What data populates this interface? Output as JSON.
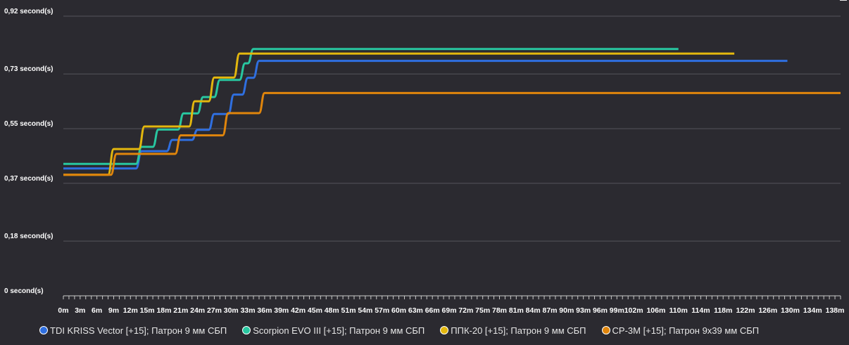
{
  "chart_data": {
    "type": "line",
    "step": true,
    "y_ticks": [
      "0 second(s)",
      "0,18 second(s)",
      "0,37 second(s)",
      "0,55 second(s)",
      "0,73 second(s)",
      "0,92 second(s)"
    ],
    "y_tick_values": [
      0,
      0.18,
      0.37,
      0.55,
      0.73,
      0.92
    ],
    "ylim": [
      0,
      0.92
    ],
    "x_ticks": [
      "0m",
      "3m",
      "6m",
      "9m",
      "12m",
      "15m",
      "18m",
      "21m",
      "24m",
      "27m",
      "30m",
      "33m",
      "36m",
      "39m",
      "42m",
      "45m",
      "48m",
      "51m",
      "54m",
      "57m",
      "60m",
      "63m",
      "66m",
      "69m",
      "72m",
      "75m",
      "78m",
      "81m",
      "84m",
      "87m",
      "90m",
      "93m",
      "96m",
      "99m",
      "102m",
      "106m",
      "110m",
      "114m",
      "118m",
      "122m",
      "126m",
      "130m",
      "134m",
      "138m"
    ],
    "x_tick_values": [
      0,
      3,
      6,
      9,
      12,
      15,
      18,
      21,
      24,
      27,
      30,
      33,
      36,
      39,
      42,
      45,
      48,
      51,
      54,
      57,
      60,
      63,
      66,
      69,
      72,
      75,
      78,
      81,
      84,
      87,
      90,
      93,
      96,
      99,
      102,
      106,
      110,
      114,
      118,
      122,
      126,
      130,
      134,
      138
    ],
    "xlim": [
      0,
      139
    ],
    "grid": true,
    "legend_position": "bottom",
    "series": [
      {
        "name": "TDI KRISS Vector [+15]; Патрон 9 мм СБП",
        "color": "#2f6fe0",
        "points": [
          [
            0,
            0.419
          ],
          [
            13,
            0.419
          ],
          [
            14,
            0.476
          ],
          [
            18.5,
            0.476
          ],
          [
            19.5,
            0.513
          ],
          [
            23,
            0.513
          ],
          [
            24,
            0.546
          ],
          [
            26,
            0.546
          ],
          [
            27,
            0.598
          ],
          [
            29.5,
            0.598
          ],
          [
            30.5,
            0.662
          ],
          [
            32,
            0.662
          ],
          [
            33,
            0.717
          ],
          [
            34,
            0.717
          ],
          [
            35,
            0.773
          ],
          [
            129.5,
            0.773
          ]
        ]
      },
      {
        "name": "Scorpion EVO III [+15]; Патрон 9 мм СБП",
        "color": "#28c7a0",
        "points": [
          [
            0,
            0.434
          ],
          [
            13,
            0.434
          ],
          [
            14,
            0.49
          ],
          [
            16,
            0.49
          ],
          [
            17,
            0.547
          ],
          [
            20.5,
            0.547
          ],
          [
            21.5,
            0.6
          ],
          [
            24,
            0.6
          ],
          [
            25,
            0.654
          ],
          [
            27,
            0.654
          ],
          [
            28,
            0.71
          ],
          [
            31.5,
            0.71
          ],
          [
            32.5,
            0.765
          ],
          [
            33,
            0.765
          ],
          [
            34,
            0.812
          ],
          [
            110,
            0.812
          ]
        ]
      },
      {
        "name": "ППК-20 [+15]; Патрон 9 мм СБП",
        "color": "#e3b70e",
        "points": [
          [
            0,
            0.398
          ],
          [
            8,
            0.398
          ],
          [
            9,
            0.483
          ],
          [
            13.5,
            0.483
          ],
          [
            14.5,
            0.557
          ],
          [
            22.5,
            0.557
          ],
          [
            23.5,
            0.64
          ],
          [
            26,
            0.64
          ],
          [
            27,
            0.718
          ],
          [
            30.5,
            0.718
          ],
          [
            31.5,
            0.797
          ],
          [
            120,
            0.797
          ]
        ]
      },
      {
        "name": "СР-3М [+15]; Патрон 9х39 мм СБП",
        "color": "#e0850c",
        "points": [
          [
            0,
            0.398
          ],
          [
            8.5,
            0.398
          ],
          [
            9.5,
            0.467
          ],
          [
            20,
            0.467
          ],
          [
            21,
            0.528
          ],
          [
            28.5,
            0.528
          ],
          [
            29.5,
            0.601
          ],
          [
            35,
            0.601
          ],
          [
            36,
            0.667
          ],
          [
            139,
            0.667
          ]
        ]
      }
    ]
  }
}
